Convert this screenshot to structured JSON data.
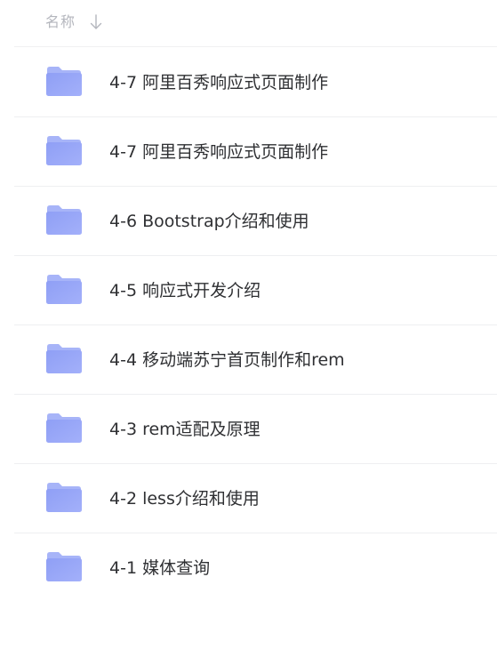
{
  "header": {
    "name_label": "名称",
    "sort_icon": "arrow-down-icon"
  },
  "folder_icon": "folder-icon",
  "colors": {
    "folder_front": "#8f9ff5",
    "folder_back": "#a7b4f8",
    "text": "#2f3033",
    "header_text": "#b4b6bd",
    "divider": "#eeeff1"
  },
  "folders": [
    {
      "name": "4-7 阿里百秀响应式页面制作"
    },
    {
      "name": "4-7 阿里百秀响应式页面制作"
    },
    {
      "name": "4-6 Bootstrap介绍和使用"
    },
    {
      "name": "4-5 响应式开发介绍"
    },
    {
      "name": "4-4 移动端苏宁首页制作和rem"
    },
    {
      "name": "4-3 rem适配及原理"
    },
    {
      "name": "4-2 less介绍和使用"
    },
    {
      "name": "4-1 媒体查询"
    }
  ]
}
